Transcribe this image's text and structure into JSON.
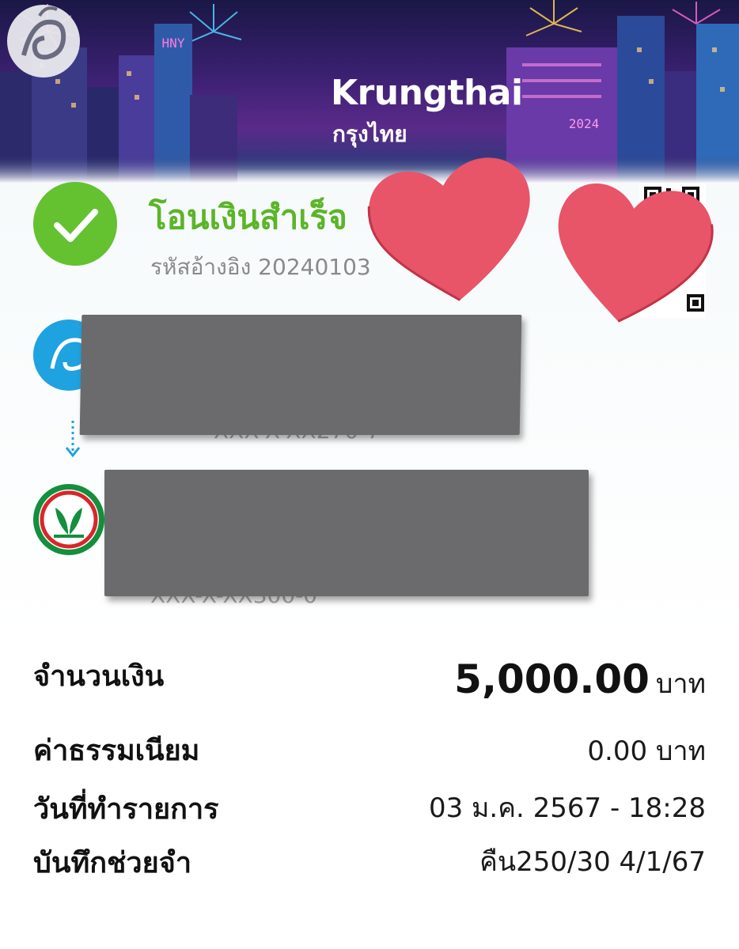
{
  "header": {
    "brand_en": "Krungthai",
    "brand_th": "กรุงไทย",
    "banner_sign": "HNY",
    "banner_year": "2024"
  },
  "status": {
    "title": "โอนเงินสำเร็จ",
    "reference": "รหัสอ้างอิง 20240103"
  },
  "accounts": {
    "from_partial": "XXX-X-XX270-7",
    "to_partial": "XXX-X-XX300-0"
  },
  "details": {
    "amount_label": "จำนวนเงิน",
    "amount_value": "5,000.00",
    "amount_unit": "บาท",
    "fee_label": "ค่าธรรมเนียม",
    "fee_value": "0.00 บาท",
    "date_label": "วันที่ทำรายการ",
    "date_value": "03 ม.ค. 2567 - 18:28",
    "memo_label": "บันทึกช่วยจำ",
    "memo_value": "คืน250/30 4/1/67"
  },
  "colors": {
    "success_green": "#5bb528",
    "heart_pink": "#e85468",
    "redaction_gray": "#6b6b6d",
    "kbank_green": "#138f3e",
    "ktb_blue": "#1fa2e0"
  },
  "icons": [
    "check-icon",
    "qr-code-icon",
    "heart-sticker",
    "ktb-logo-icon",
    "kbank-logo-icon",
    "arrow-down-icon"
  ]
}
